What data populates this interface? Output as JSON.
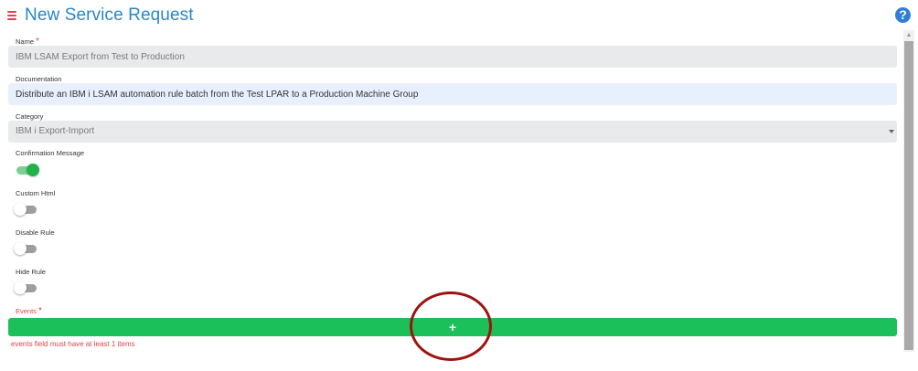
{
  "header": {
    "title": "New Service Request",
    "menu_icon": "hamburger-menu-icon",
    "help_icon": "help-circle-icon",
    "help_glyph": "?",
    "accent_color": "#2a86c5"
  },
  "form": {
    "name": {
      "label": "Name",
      "required_mark": "*",
      "value": "IBM LSAM Export from Test to Production"
    },
    "documentation": {
      "label": "Documentation",
      "value": "Distribute an IBM i LSAM automation rule batch from the Test LPAR to a Production Machine Group"
    },
    "category": {
      "label": "Category",
      "selected": "IBM i Export-Import",
      "caret_icon": "caret-down-icon"
    },
    "toggles": {
      "confirmation_message": {
        "label": "Confirmation Message",
        "checked": true
      },
      "custom_html": {
        "label": "Custom Html",
        "checked": false
      },
      "disable_rule": {
        "label": "Disable Rule",
        "checked": false
      },
      "hide_rule": {
        "label": "Hide Rule",
        "checked": false
      }
    },
    "events": {
      "label": "Events",
      "required_mark": "*",
      "add_label": "+",
      "error": "events field must have at least 1 items"
    }
  },
  "colors": {
    "add_button": "#1cc05a",
    "toggle_on": "#22b24c",
    "error": "#e0444a",
    "highlight_circle": "#9f1212"
  }
}
